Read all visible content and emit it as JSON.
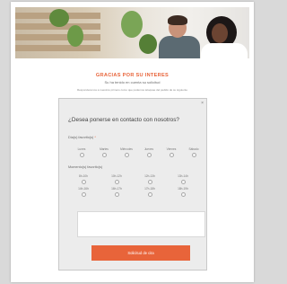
{
  "header": {
    "image_alt": ""
  },
  "confirmation": {
    "title": "GRACIAS POR SU INTERES",
    "subtitle": "Su ha tenido en cuenta su solicitud",
    "note": "Responderemos a nuestros primero como que podemos teloquae del pedido de su siguiente"
  },
  "form": {
    "title": "¿Desea ponerse en contacto con nosotros?",
    "close_label": "×",
    "days_label": "Día(s) favorito(s)",
    "required_mark": "*",
    "days": [
      "Lunes",
      "Martes",
      "Miércoles",
      "Jueves",
      "Viernes",
      "Sábado"
    ],
    "times_label": "Momento(s) favorito(s)",
    "times_row1": [
      "8h-10h",
      "10h-12h",
      "12h-13h",
      "13h-14h"
    ],
    "times_row2": [
      "14h-16h",
      "16h-17h",
      "17h-18h",
      "18h-19h"
    ],
    "textarea_value": "",
    "submit_label": "Solicitud de cita"
  },
  "colors": {
    "accent": "#e8643a",
    "panel": "#ececec"
  }
}
